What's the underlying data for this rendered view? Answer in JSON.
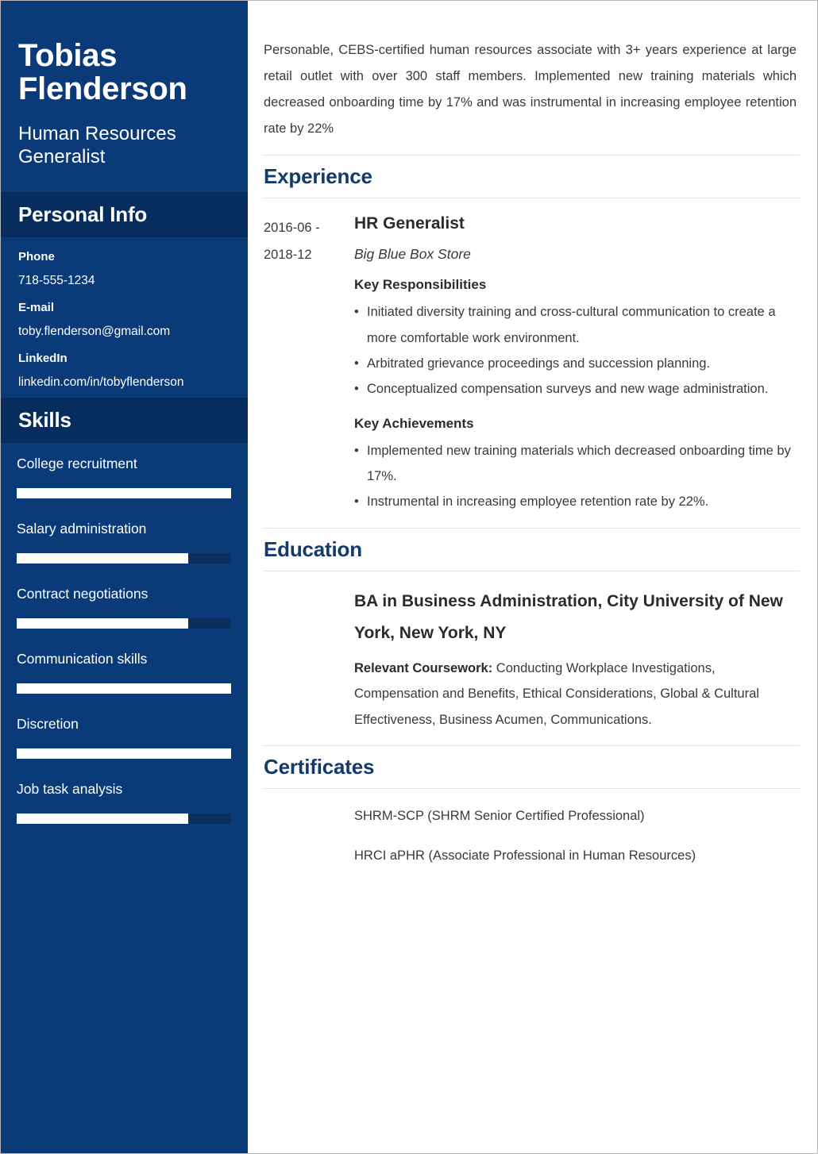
{
  "sidebar": {
    "name": "Tobias Flenderson",
    "job_title": "Human Resources Generalist",
    "personal_info": {
      "heading": "Personal Info",
      "fields": [
        {
          "label": "Phone",
          "value": "718-555-1234"
        },
        {
          "label": "E-mail",
          "value": "toby.flenderson@gmail.com"
        },
        {
          "label": "LinkedIn",
          "value": "linkedin.com/in/tobyflenderson"
        }
      ]
    },
    "skills": {
      "heading": "Skills",
      "items": [
        {
          "name": "College recruitment",
          "level": 100
        },
        {
          "name": "Salary administration",
          "level": 80
        },
        {
          "name": "Contract negotiations",
          "level": 80
        },
        {
          "name": "Communication skills",
          "level": 100
        },
        {
          "name": "Discretion",
          "level": 100
        },
        {
          "name": "Job task analysis",
          "level": 80
        }
      ]
    }
  },
  "main": {
    "summary": "Personable, CEBS-certified human resources associate with 3+ years experience at large retail outlet with over 300 staff members. Implemented new training materials which decreased onboarding time by 17% and was instrumental in increasing employee retention rate by 22%",
    "experience": {
      "heading": "Experience",
      "entries": [
        {
          "date_start": "2016-06 -",
          "date_end": "2018-12",
          "role": "HR Generalist",
          "company": "Big Blue Box Store",
          "responsibilities_heading": "Key Responsibilities",
          "responsibilities": [
            "Initiated diversity training and cross-cultural communication to create a more comfortable work environment.",
            "Arbitrated grievance proceedings and succession planning.",
            "Conceptualized compensation surveys and new wage administration."
          ],
          "achievements_heading": "Key Achievements",
          "achievements": [
            "Implemented new training materials which decreased onboarding time by 17%.",
            "Instrumental in increasing employee retention rate by 22%."
          ]
        }
      ]
    },
    "education": {
      "heading": "Education",
      "degree": "BA in Business Administration, City University of New York, New York, NY",
      "coursework_label": "Relevant Coursework:",
      "coursework": " Conducting Workplace Investigations, Compensation and Benefits, Ethical Considerations, Global & Cultural Effectiveness, Business Acumen, Communications."
    },
    "certificates": {
      "heading": "Certificates",
      "items": [
        "SHRM-SCP (SHRM Senior Certified Professional)",
        "HRCI aPHR (Associate Professional in Human Resources)"
      ]
    }
  },
  "colors": {
    "sidebar_blue": "#0a3a77",
    "band_navy": "#072d5e",
    "heading_blue": "#133a6b",
    "bar_track": "#0b2f5c",
    "bar_fill": "#ffffff"
  }
}
